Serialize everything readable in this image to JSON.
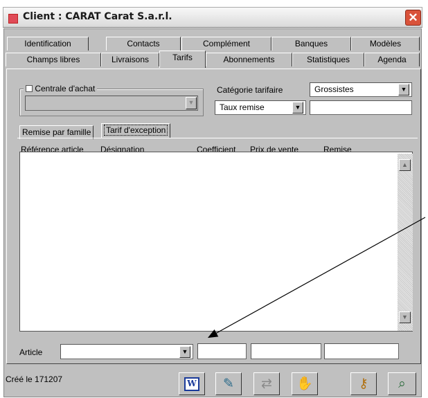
{
  "window": {
    "title": "Client : CARAT Carat S.a.r.l.",
    "close_symbol": "✕",
    "accent_color": "#e04a57"
  },
  "tabs": {
    "row1": [
      "Identification",
      "Contacts",
      "Complément",
      "Banques",
      "Modèles"
    ],
    "row2": [
      "Champs libres",
      "Livraisons",
      "Tarifs",
      "Abonnements",
      "Statistiques",
      "Agenda"
    ],
    "active": "Tarifs"
  },
  "form": {
    "centrale_label": "Centrale d'achat",
    "centrale_value": "",
    "categorie_label": "Catégorie tarifaire",
    "categorie_value": "Grossistes",
    "taux_value": "Taux remise",
    "taux_input": ""
  },
  "subtabs": {
    "items": [
      "Remise par famille",
      "Tarif d'exception"
    ],
    "active": "Tarif d'exception"
  },
  "table": {
    "columns": [
      "Référence article",
      "Désignation",
      "Coefficient",
      "Prix de vente",
      "Remise"
    ],
    "rows": []
  },
  "article": {
    "label": "Article",
    "value": "",
    "coefficient": "",
    "prix": "",
    "remise": ""
  },
  "status": {
    "created": "Créé le 171207"
  },
  "toolbar": {
    "icons": [
      "word-icon",
      "edit-icon",
      "transfer-icon",
      "handshake-icon",
      "user-key-icon",
      "search-user-icon"
    ]
  }
}
